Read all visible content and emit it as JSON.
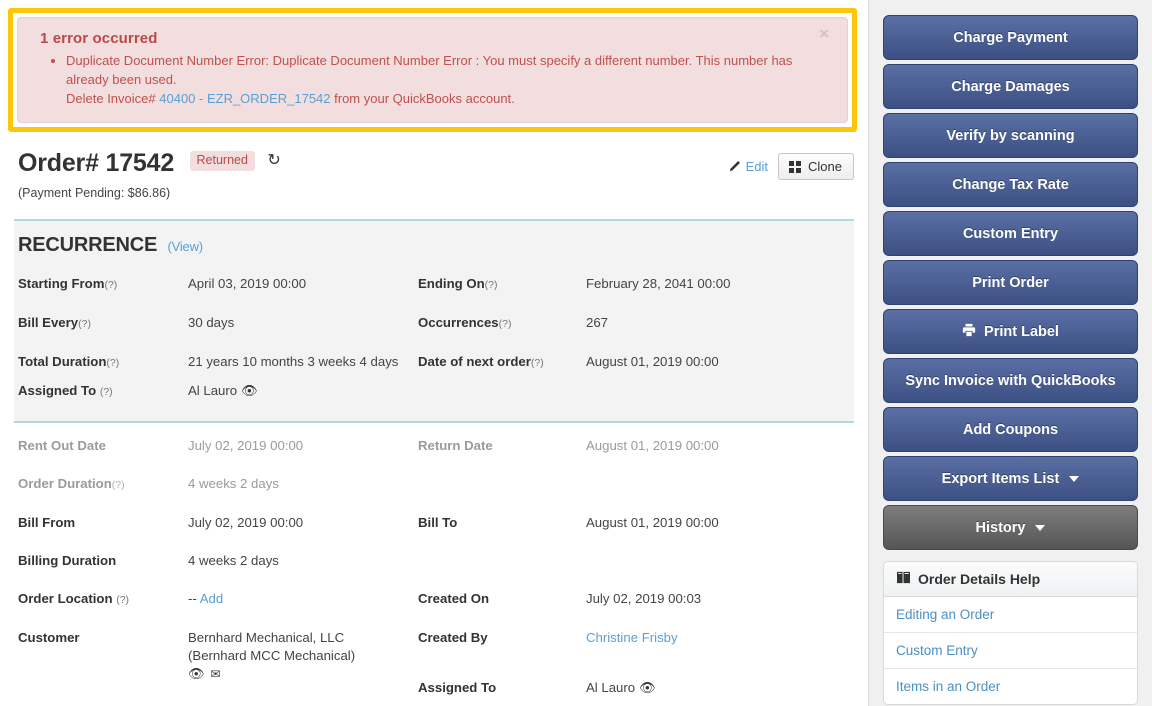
{
  "alert": {
    "title": "1 error occurred",
    "close_label": "×",
    "items": [
      {
        "line1": "Duplicate Document Number Error: Duplicate Document Number Error : You must specify a different number. This number has already been used.",
        "line2_prefix": "Delete Invoice#",
        "line2_link": "40400 - EZR_ORDER_17542",
        "line2_suffix": "from your QuickBooks account."
      }
    ],
    "border_color": "#FCC60A",
    "bg_color": "#f2dede",
    "text_color": "#b94a48"
  },
  "header": {
    "title": "Order# 17542",
    "status_badge": "Returned",
    "refresh_icon": "refresh-icon",
    "subtitle": "(Payment Pending: $86.86)",
    "edit_label": "Edit",
    "clone_label": "Clone"
  },
  "recurrence": {
    "heading": "RECURRENCE",
    "view_label": "(View)",
    "fields": [
      {
        "label": "Starting From",
        "hint": "(?)",
        "value": "April 03, 2019 00:00"
      },
      {
        "label": "Ending On",
        "hint": "(?)",
        "value": "February 28, 2041 00:00"
      },
      {
        "label": "Bill Every",
        "hint": "(?)",
        "value": "30 days"
      },
      {
        "label": "Occurrences",
        "hint": "(?)",
        "value": "267"
      },
      {
        "label": "Total Duration",
        "hint": "(?)",
        "value": "21 years 10 months 3 weeks 4 days"
      },
      {
        "label": "Date of next order",
        "hint": "(?)",
        "value": "August 01, 2019 00:00"
      },
      {
        "label": "Assigned To",
        "hint": "(?)",
        "value": "Al Lauro"
      }
    ]
  },
  "details": {
    "rent_out_date": {
      "label": "Rent Out Date",
      "value": "July 02, 2019 00:00"
    },
    "return_date": {
      "label": "Return Date",
      "value": "August 01, 2019 00:00"
    },
    "order_duration": {
      "label": "Order Duration",
      "hint": "(?)",
      "value": "4 weeks 2 days"
    },
    "bill_from": {
      "label": "Bill From",
      "value": "July 02, 2019 00:00"
    },
    "bill_to": {
      "label": "Bill To",
      "value": "August 01, 2019 00:00"
    },
    "billing_duration": {
      "label": "Billing Duration",
      "value": "4 weeks 2 days"
    },
    "order_location": {
      "label": "Order Location",
      "hint": "(?)",
      "prefix": "--",
      "link": "Add"
    },
    "created_on": {
      "label": "Created On",
      "value": "July 02, 2019 00:03"
    },
    "customer": {
      "label": "Customer",
      "line1": "Bernhard Mechanical, LLC",
      "line2": "(Bernhard MCC Mechanical)"
    },
    "created_by": {
      "label": "Created By",
      "value": "Christine Frisby"
    },
    "assigned_to": {
      "label": "Assigned To",
      "value": "Al Lauro"
    }
  },
  "sidebar": {
    "buttons": [
      {
        "label": "Charge Payment",
        "icon": null,
        "caret": false,
        "style": "blue"
      },
      {
        "label": "Charge Damages",
        "icon": null,
        "caret": false,
        "style": "blue"
      },
      {
        "label": "Verify by scanning",
        "icon": null,
        "caret": false,
        "style": "blue"
      },
      {
        "label": "Change Tax Rate",
        "icon": null,
        "caret": false,
        "style": "blue"
      },
      {
        "label": "Custom Entry",
        "icon": null,
        "caret": false,
        "style": "blue"
      },
      {
        "label": "Print Order",
        "icon": null,
        "caret": false,
        "style": "blue"
      },
      {
        "label": "Print Label",
        "icon": "printer-icon",
        "caret": false,
        "style": "blue"
      },
      {
        "label": "Sync Invoice with QuickBooks",
        "icon": null,
        "caret": false,
        "style": "blue"
      },
      {
        "label": "Add Coupons",
        "icon": null,
        "caret": false,
        "style": "blue"
      },
      {
        "label": "Export Items List",
        "icon": null,
        "caret": true,
        "style": "blue"
      },
      {
        "label": "History",
        "icon": null,
        "caret": true,
        "style": "grey"
      }
    ],
    "help": {
      "title": "Order Details Help",
      "icon": "book-icon",
      "items": [
        "Editing an Order",
        "Custom Entry",
        "Items in an Order"
      ]
    },
    "accent_blue": "#3c5084",
    "accent_grey": "#565656"
  }
}
